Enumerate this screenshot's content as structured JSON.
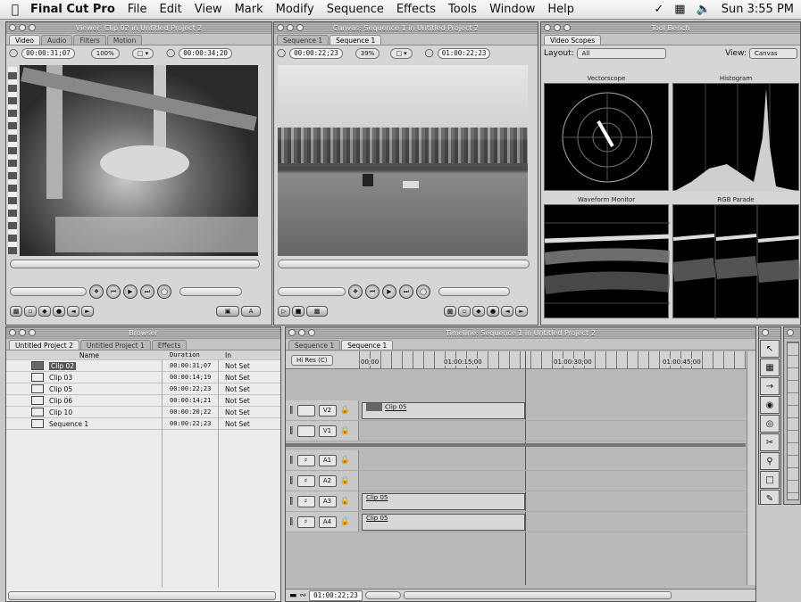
{
  "menubar": {
    "app": "Final Cut Pro",
    "items": [
      "File",
      "Edit",
      "View",
      "Mark",
      "Modify",
      "Sequence",
      "Effects",
      "Tools",
      "Window",
      "Help"
    ],
    "clock": "Sun 3:55 PM"
  },
  "viewer": {
    "title": "Viewer: Clip 02 in Untitled Project 2",
    "tabs": [
      "Video",
      "Audio",
      "Filters",
      "Motion"
    ],
    "duration": "00:00:31;07",
    "zoom": "100%",
    "current": "00:00:34;20"
  },
  "canvas": {
    "title": "Canvas: Sequence 1 in Untitled Project 2",
    "tabs": [
      "Sequence 1",
      "Sequence 1"
    ],
    "duration": "00:00:22;23",
    "zoom": "39%",
    "current": "01:00:22;23"
  },
  "toolbench": {
    "title": "Tool Bench",
    "tab": "Video Scopes",
    "layout_label": "Layout:",
    "layout": "All",
    "view_label": "View:",
    "view": "Canvas",
    "scopes": [
      "Vectorscope",
      "Histogram",
      "Waveform Monitor",
      "RGB Parade"
    ]
  },
  "browser": {
    "title": "Browser",
    "tabs": [
      "Untitled Project 2",
      "Untitled Project 1",
      "Effects"
    ],
    "columns": [
      "Name",
      "Duration",
      "In"
    ],
    "rows": [
      {
        "name": "Clip 02",
        "duration": "00:00:31;07",
        "in": "Not Set"
      },
      {
        "name": "Clip 03",
        "duration": "00:00:14;19",
        "in": "Not Set"
      },
      {
        "name": "Clip 05",
        "duration": "00:00:22;23",
        "in": "Not Set"
      },
      {
        "name": "Clip 06",
        "duration": "00:00:14;21",
        "in": "Not Set"
      },
      {
        "name": "Clip 10",
        "duration": "00:00:20;22",
        "in": "Not Set"
      },
      {
        "name": "Sequence 1",
        "duration": "00:00:22;23",
        "in": "Not Set"
      }
    ]
  },
  "timeline": {
    "title": "Timeline: Sequence 1 in Untitled Project 2",
    "tabs": [
      "Sequence 1",
      "Sequence 1"
    ],
    "res": "Hi Res (C)",
    "ruler": [
      "00;00",
      "01:00:15;00",
      "01:00:30;00",
      "01:00:45;00"
    ],
    "tracks": [
      {
        "label": "V2",
        "clip": "Clip 05"
      },
      {
        "label": "V1",
        "clip": ""
      },
      {
        "label": "A1",
        "clip": ""
      },
      {
        "label": "A2",
        "clip": ""
      },
      {
        "label": "A3",
        "clip": "Clip 05"
      },
      {
        "label": "A4",
        "clip": "Clip 05"
      }
    ],
    "timecode": "01:00:22;23"
  }
}
